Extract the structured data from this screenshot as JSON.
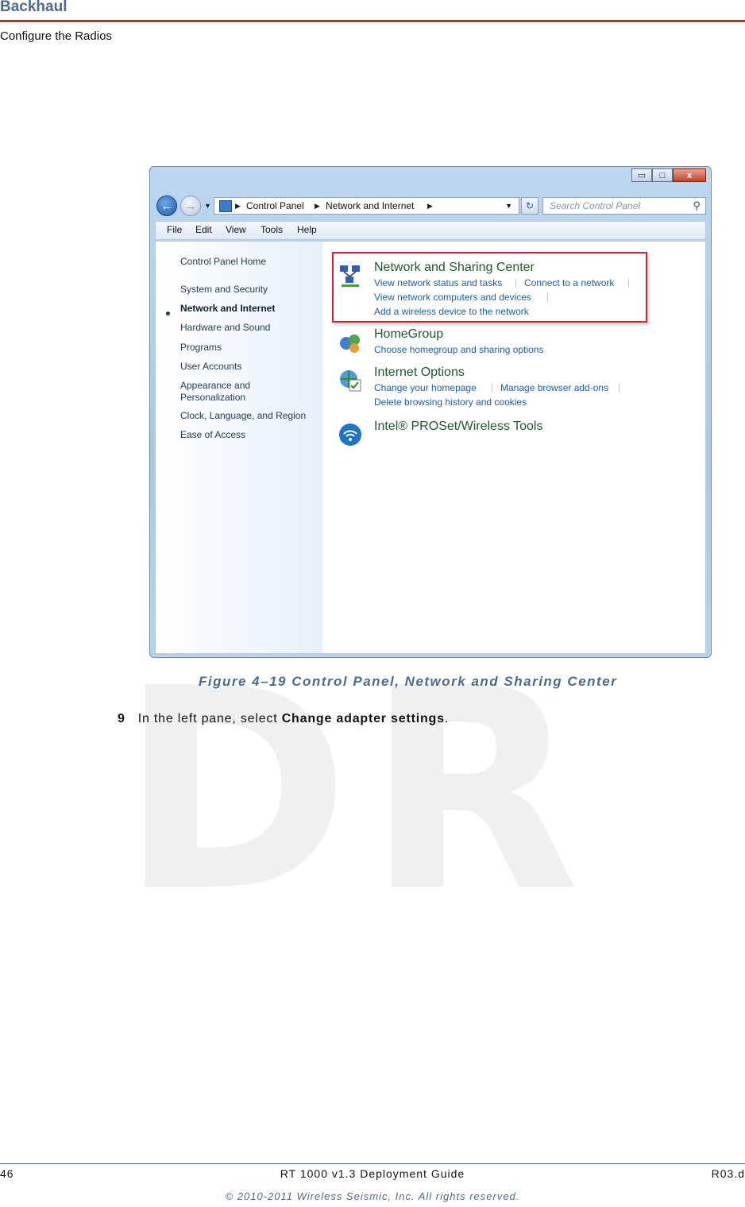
{
  "header": {
    "section": "Backhaul",
    "subsection": "Configure the Radios"
  },
  "screenshot": {
    "window_controls": {
      "minimize": "▭",
      "maximize": "□",
      "close": "x"
    },
    "address": {
      "crumb1": "Control Panel",
      "crumb2": "Network and Internet"
    },
    "search_placeholder": "Search Control Panel",
    "menu": [
      "File",
      "Edit",
      "View",
      "Tools",
      "Help"
    ],
    "left_pane": [
      "Control Panel Home",
      "System and Security",
      "Network and Internet",
      "Hardware and Sound",
      "Programs",
      "User Accounts",
      "Appearance and Personalization",
      "Clock, Language, and Region",
      "Ease of Access"
    ],
    "categories": {
      "network": {
        "title": "Network and Sharing Center",
        "links": [
          "View network status and tasks",
          "Connect to a network",
          "View network computers and devices",
          "Add a wireless device to the network"
        ]
      },
      "homegroup": {
        "title": "HomeGroup",
        "links": [
          "Choose homegroup and sharing options"
        ]
      },
      "internet": {
        "title": "Internet Options",
        "links": [
          "Change your homepage",
          "Manage browser add-ons",
          "Delete browsing history and cookies"
        ]
      },
      "intel": {
        "title": "Intel® PROSet/Wireless Tools"
      }
    }
  },
  "figure_caption": "Figure 4–19  Control Panel, Network and Sharing Center",
  "step": {
    "number": "9",
    "text_before": "In the left pane, select ",
    "bold": "Change adapter settings",
    "text_after": "."
  },
  "watermark": "DR",
  "footer": {
    "page": "46",
    "doc": "RT 1000 v1.3 Deployment Guide",
    "rev": "R03.d",
    "copyright": "© 2010-2011 Wireless Seismic, Inc. All rights reserved."
  }
}
